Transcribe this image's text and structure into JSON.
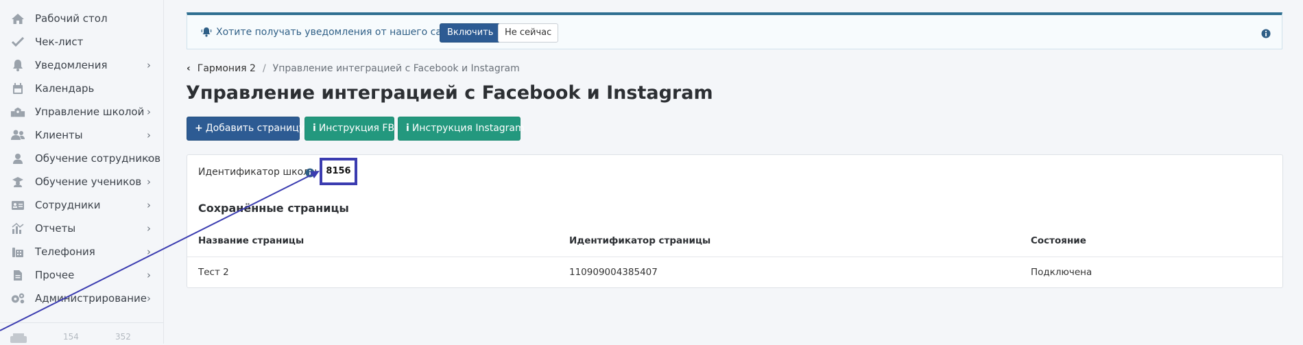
{
  "sidebar": {
    "items": [
      {
        "label": "Рабочий стол",
        "icon": "home-icon",
        "has_children": false
      },
      {
        "label": "Чек-лист",
        "icon": "check-icon",
        "has_children": false
      },
      {
        "label": "Уведомления",
        "icon": "bell-icon",
        "has_children": true
      },
      {
        "label": "Календарь",
        "icon": "calendar-icon",
        "has_children": false
      },
      {
        "label": "Управление школой",
        "icon": "school-icon",
        "has_children": true
      },
      {
        "label": "Клиенты",
        "icon": "users-icon",
        "has_children": true
      },
      {
        "label": "Обучение сотрудников",
        "icon": "user-icon",
        "has_children": true
      },
      {
        "label": "Обучение учеников",
        "icon": "graduation-cap-icon",
        "has_children": true
      },
      {
        "label": "Сотрудники",
        "icon": "id-card-icon",
        "has_children": true
      },
      {
        "label": "Отчеты",
        "icon": "chart-icon",
        "has_children": true
      },
      {
        "label": "Телефония",
        "icon": "fax-icon",
        "has_children": true
      },
      {
        "label": "Прочее",
        "icon": "file-icon",
        "has_children": true
      },
      {
        "label": "Администрирование",
        "icon": "cogs-icon",
        "has_children": true
      }
    ],
    "chevron": "›",
    "footer": {
      "left": "154",
      "right": "352"
    }
  },
  "notification": {
    "text": "Хотите получать уведомления от нашего сайта?",
    "enable_label": "Включить",
    "later_label": "Не сейчас"
  },
  "breadcrumb": {
    "back": "‹",
    "parent": "Гармония 2",
    "separator": "/",
    "current": "Управление интеграцией с Facebook и Instagram"
  },
  "page": {
    "title": "Управление интеграцией с Facebook и Instagram",
    "buttons": {
      "add_page": "Добавить страницу",
      "add_glyph": "+",
      "fb_instructions": "Инструкция FB",
      "ig_instructions": "Инструкция Instagram",
      "info_glyph": "i"
    }
  },
  "school": {
    "id_label": "Идентификатор школы",
    "id_value": "8156"
  },
  "saved_pages": {
    "title": "Сохранённые страницы",
    "columns": [
      "Название страницы",
      "Идентификатор страницы",
      "Состояние"
    ],
    "rows": [
      [
        "Тест 2",
        "110909004385407",
        "Подключена"
      ]
    ]
  },
  "colors": {
    "primary": "#2d5b93",
    "success": "#23987e",
    "annotation": "#3b3cb0",
    "notify_border": "#2f6f91"
  }
}
